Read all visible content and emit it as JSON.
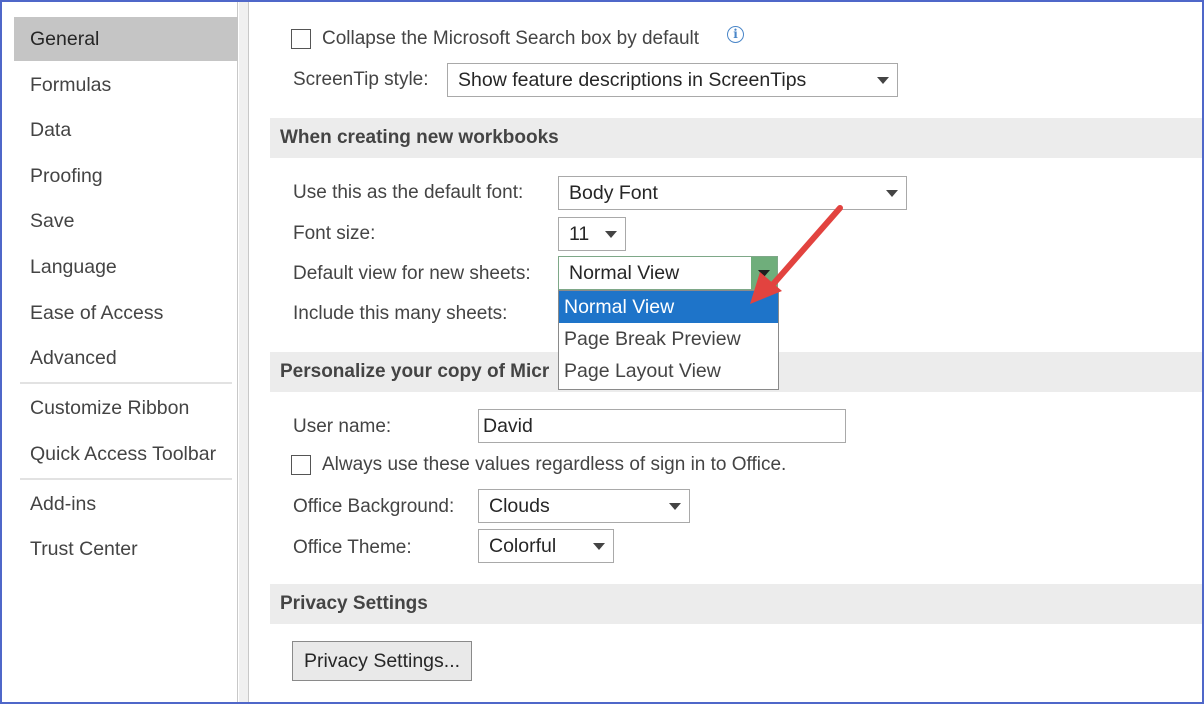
{
  "sidebar": {
    "items": [
      {
        "label": "General"
      },
      {
        "label": "Formulas"
      },
      {
        "label": "Data"
      },
      {
        "label": "Proofing"
      },
      {
        "label": "Save"
      },
      {
        "label": "Language"
      },
      {
        "label": "Ease of Access"
      },
      {
        "label": "Advanced"
      },
      {
        "label": "Customize Ribbon"
      },
      {
        "label": "Quick Access Toolbar"
      },
      {
        "label": "Add-ins"
      },
      {
        "label": "Trust Center"
      }
    ],
    "selected": "General"
  },
  "search_box": {
    "collapse_label": "Collapse the Microsoft Search box by default",
    "collapse_checked": false,
    "info_icon": "info-icon"
  },
  "screentip": {
    "label": "ScreenTip style:",
    "value": "Show feature descriptions in ScreenTips"
  },
  "new_workbooks": {
    "header": "When creating new workbooks",
    "default_font_label": "Use this as the default font:",
    "default_font_value": "Body Font",
    "font_size_label": "Font size:",
    "font_size_value": "11",
    "default_view_label": "Default view for new sheets:",
    "default_view_value": "Normal View",
    "default_view_options": [
      "Normal View",
      "Page Break Preview",
      "Page Layout View"
    ],
    "highlighted_option": "Normal View",
    "sheets_label": "Include this many sheets:"
  },
  "personalize": {
    "header": "Personalize your copy of Micr",
    "username_label": "User name:",
    "username_value": "David",
    "always_use_label": "Always use these values regardless of sign in to Office.",
    "always_use_checked": false,
    "background_label": "Office Background:",
    "background_value": "Clouds",
    "theme_label": "Office Theme:",
    "theme_value": "Colorful"
  },
  "privacy": {
    "header": "Privacy Settings",
    "button_label": "Privacy Settings..."
  },
  "colors": {
    "selected_nav": "#c5c5c5",
    "highlight": "#1e74c9",
    "annotation_arrow": "#e2433f",
    "dropdown_active": "#6fae7b"
  }
}
